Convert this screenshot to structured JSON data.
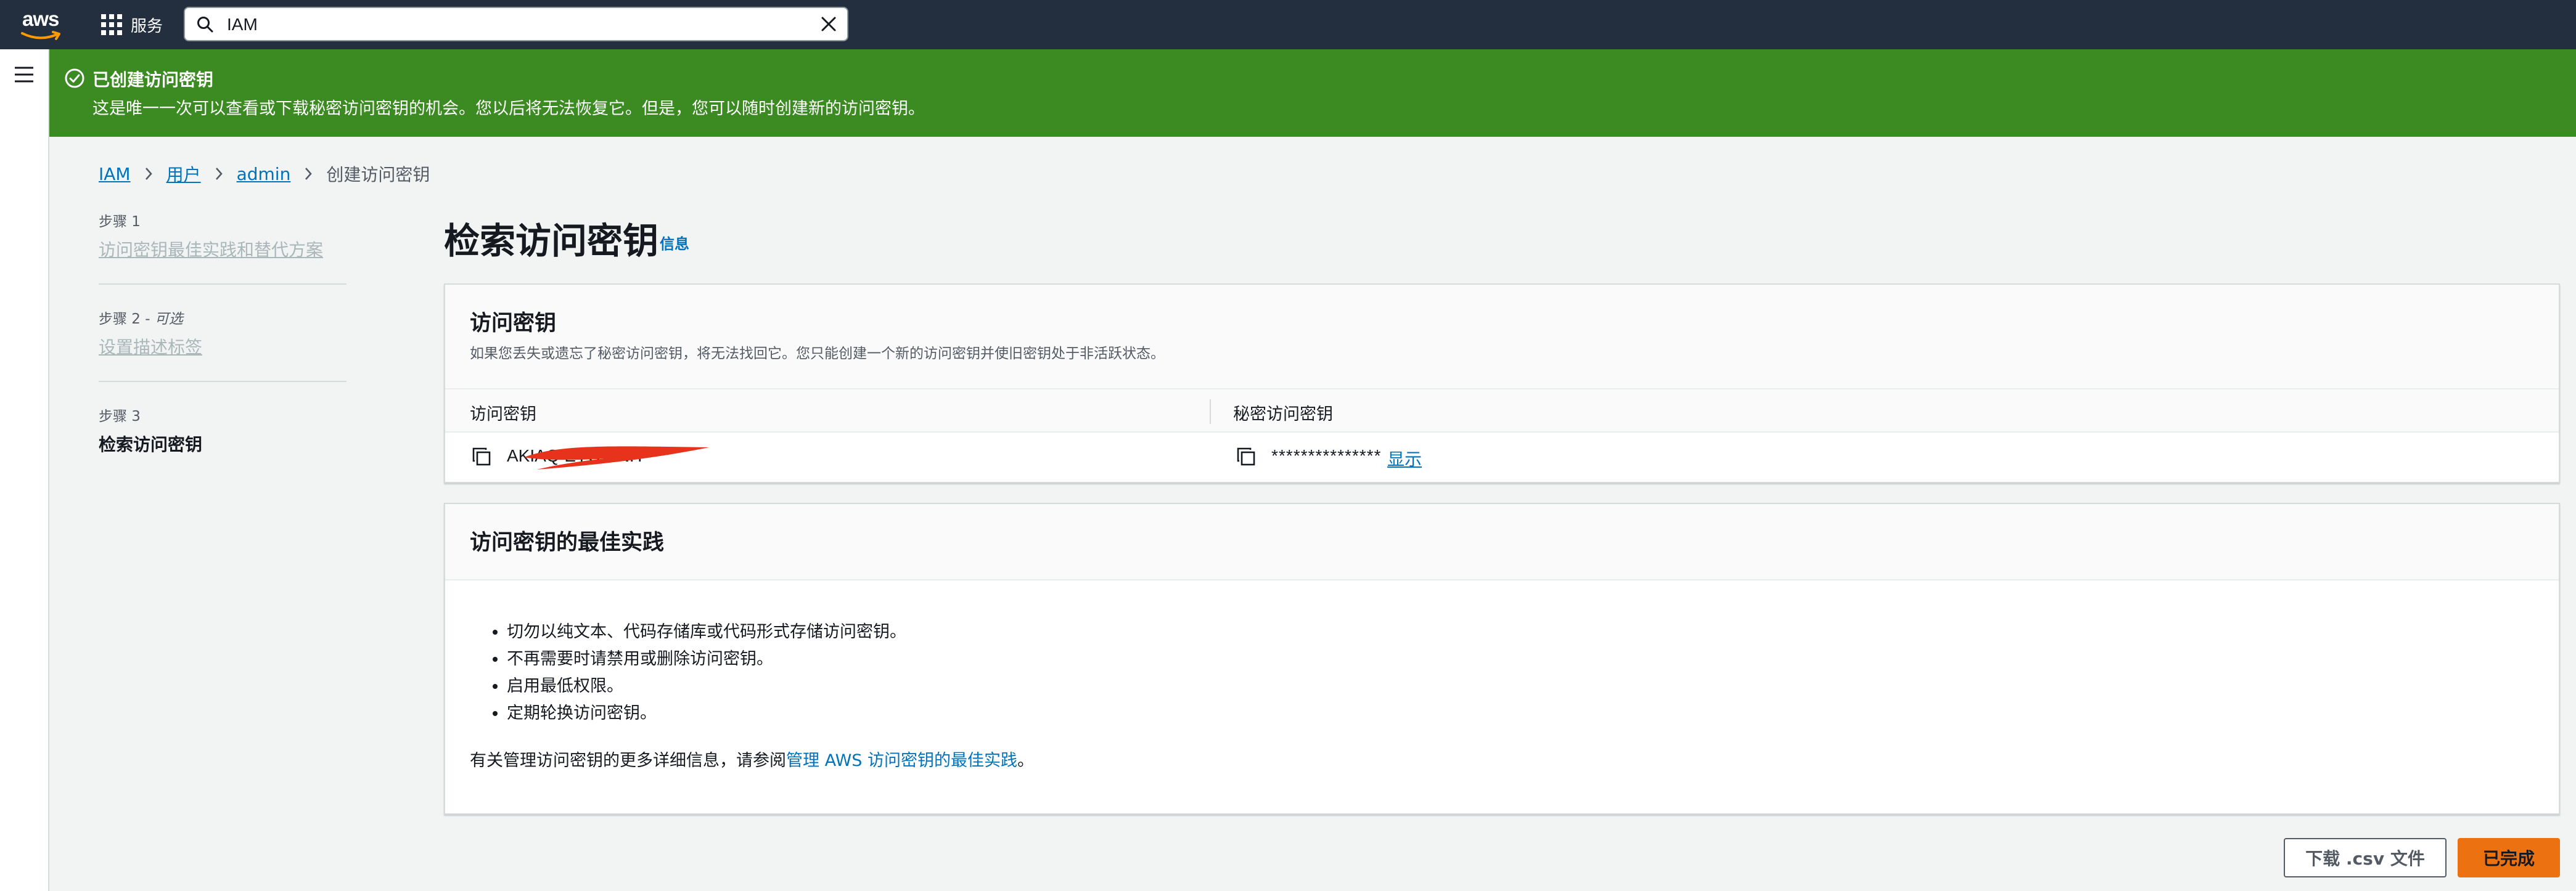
{
  "topnav": {
    "logo_text": "aws",
    "services_label": "服务",
    "search_value": "IAM"
  },
  "flash": {
    "title": "已创建访问密钥",
    "message": "这是唯一一次可以查看或下载秘密访问密钥的机会。您以后将无法恢复它。但是，您可以随时创建新的访问密钥。"
  },
  "breadcrumb": [
    "IAM",
    "用户",
    "admin",
    "创建访问密钥"
  ],
  "steps": [
    {
      "number": "步骤 1",
      "optional": "",
      "name": "访问密钥最佳实践和替代方案",
      "active": false
    },
    {
      "number": "步骤 2 - ",
      "optional": "可选",
      "name": "设置描述标签",
      "active": false
    },
    {
      "number": "步骤 3",
      "optional": "",
      "name": "检索访问密钥",
      "active": true
    }
  ],
  "page": {
    "title": "检索访问密钥",
    "info_link": "信息"
  },
  "access_key_card": {
    "title": "访问密钥",
    "description": "如果您丢失或遗忘了秘密访问密钥，将无法找回它。您只能创建一个新的访问密钥并使旧密钥处于非活跃状态。",
    "col_access_key": "访问密钥",
    "col_secret_key": "秘密访问密钥",
    "access_key_value": "AKIAQ                EYOWNH",
    "secret_key_masked": "***************",
    "show_label": "显示",
    "redaction_color": "#e8331c"
  },
  "best_practice_card": {
    "title": "访问密钥的最佳实践",
    "items": [
      "切勿以纯文本、代码存储库或代码形式存储访问密钥。",
      "不再需要时请禁用或删除访问密钥。",
      "启用最低权限。",
      "定期轮换访问密钥。"
    ],
    "more_prefix": "有关管理访问密钥的更多详细信息，请参阅",
    "more_link": "管理 AWS 访问密钥的最佳实践",
    "more_suffix": "。"
  },
  "buttons": {
    "download_csv": "下载 .csv 文件",
    "done": "已完成"
  },
  "colors": {
    "nav_bg": "#232f3e",
    "flash_green": "#3b8a22",
    "link_blue": "#0073bb",
    "primary_orange": "#ec7211",
    "page_bg": "#f2f3f3"
  }
}
